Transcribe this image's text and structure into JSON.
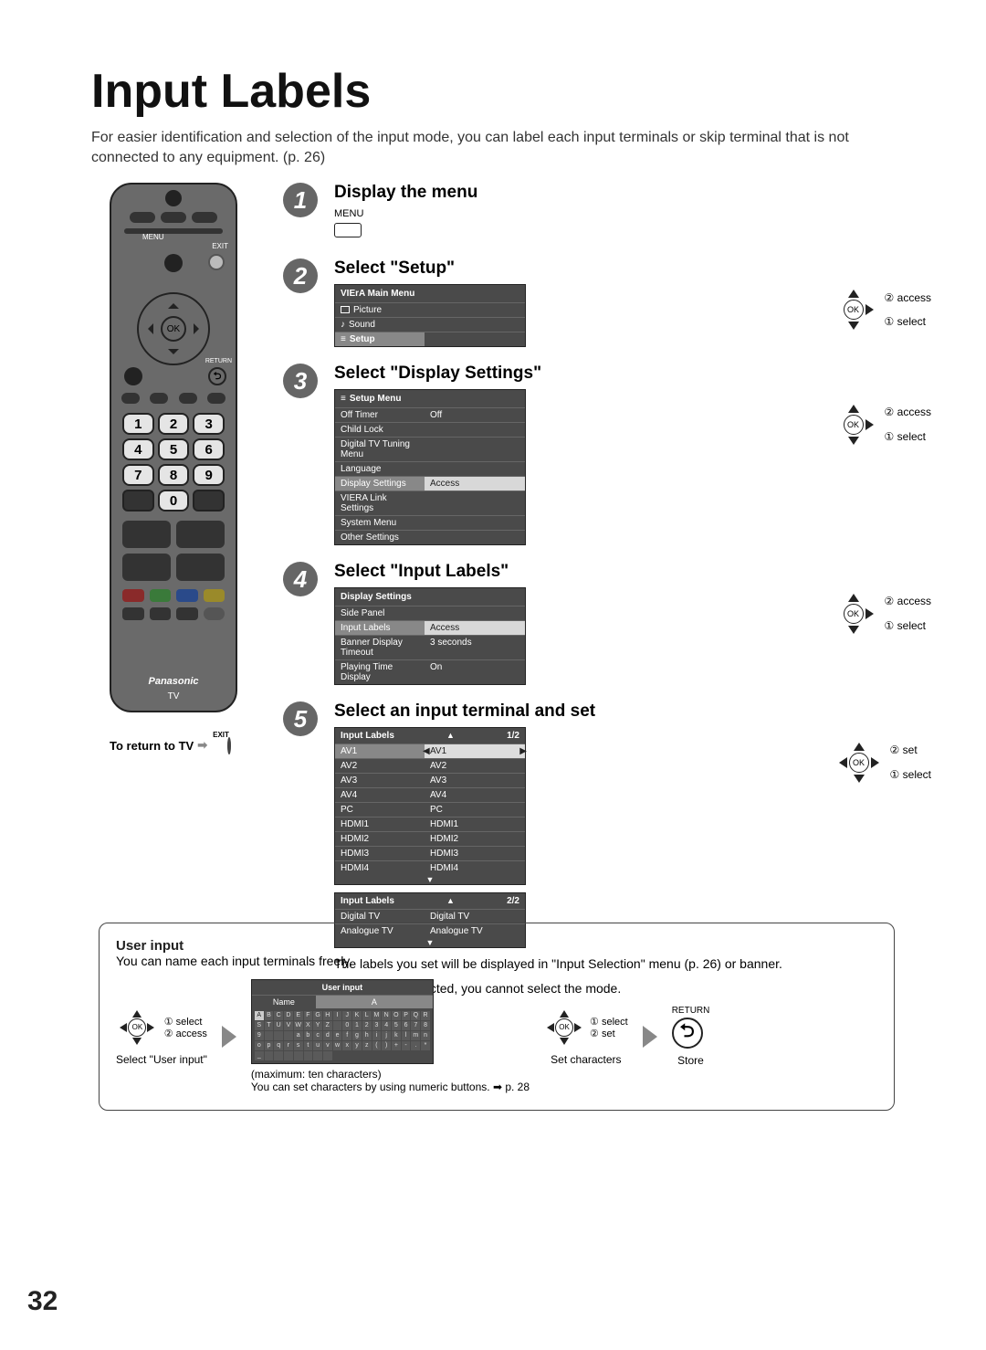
{
  "title": "Input Labels",
  "intro": "For easier identification and selection of the input mode, you can label each input terminals or skip terminal that is not connected to any equipment. (p. 26)",
  "remote": {
    "brand": "Panasonic",
    "tv": "TV",
    "ok": "OK",
    "menu": "MENU",
    "exit": "EXIT",
    "return": "RETURN",
    "ret": "⮌"
  },
  "return_to_tv": "To return to TV",
  "steps": [
    {
      "num": "1",
      "title": "Display the menu",
      "sub": "MENU"
    },
    {
      "num": "2",
      "title": "Select \"Setup\"",
      "panel": {
        "hdr": "VIErA  Main Menu",
        "items": [
          "Picture",
          "Sound",
          "Setup"
        ],
        "sel": 2
      },
      "ok": {
        "a": "② access",
        "b": "① select"
      }
    },
    {
      "num": "3",
      "title": "Select \"Display Settings\"",
      "panel": {
        "hdr": "Setup Menu",
        "rows": [
          [
            "Off Timer",
            "Off"
          ],
          [
            "Child Lock",
            ""
          ],
          [
            "Digital TV Tuning Menu",
            ""
          ],
          [
            "Language",
            ""
          ],
          [
            "Display Settings",
            "Access"
          ],
          [
            "VIERA Link Settings",
            ""
          ],
          [
            "System Menu",
            ""
          ],
          [
            "Other Settings",
            ""
          ]
        ],
        "sel": 4
      },
      "ok": {
        "a": "② access",
        "b": "① select"
      }
    },
    {
      "num": "4",
      "title": "Select \"Input Labels\"",
      "panel": {
        "hdr": "Display Settings",
        "rows": [
          [
            "Side Panel",
            ""
          ],
          [
            "Input Labels",
            "Access"
          ],
          [
            "Banner Display Timeout",
            "3 seconds"
          ],
          [
            "Playing Time Display",
            "On"
          ]
        ],
        "sel": 1
      },
      "ok": {
        "a": "② access",
        "b": "① select"
      }
    },
    {
      "num": "5",
      "title": "Select an input terminal and set",
      "panel1": {
        "hdr": "Input Labels",
        "page": "1/2",
        "rows": [
          [
            "AV1",
            "AV1"
          ],
          [
            "AV2",
            "AV2"
          ],
          [
            "AV3",
            "AV3"
          ],
          [
            "AV4",
            "AV4"
          ],
          [
            "PC",
            "PC"
          ],
          [
            "HDMI1",
            "HDMI1"
          ],
          [
            "HDMI2",
            "HDMI2"
          ],
          [
            "HDMI3",
            "HDMI3"
          ],
          [
            "HDMI4",
            "HDMI4"
          ]
        ],
        "sel": 0
      },
      "panel2": {
        "hdr": "Input Labels",
        "page": "2/2",
        "rows": [
          [
            "Digital TV",
            "Digital TV"
          ],
          [
            "Analogue TV",
            "Analogue TV"
          ]
        ]
      },
      "ok": {
        "a": "② set",
        "b": "① select"
      }
    }
  ],
  "note1": "The labels you set will be displayed in \"Input Selection\" menu (p. 26) or banner.",
  "note2": "If \"Skip\" is selected, you cannot select the mode.",
  "user": {
    "title": "User input",
    "intro": "You can name each input terminals freely.",
    "c1": {
      "a": "① select",
      "b": "② access",
      "caption": "Select \"User input\""
    },
    "c2": {
      "hdr": "User input",
      "name": "Name",
      "val": "A",
      "caption1": "(maximum: ten characters)",
      "caption2": "You can set characters by using numeric buttons. ➡ p. 28"
    },
    "c3": {
      "a": "① select",
      "b": "② set",
      "caption": "Set characters"
    },
    "c4": {
      "label": "RETURN",
      "caption": "Store"
    }
  },
  "page": "32"
}
